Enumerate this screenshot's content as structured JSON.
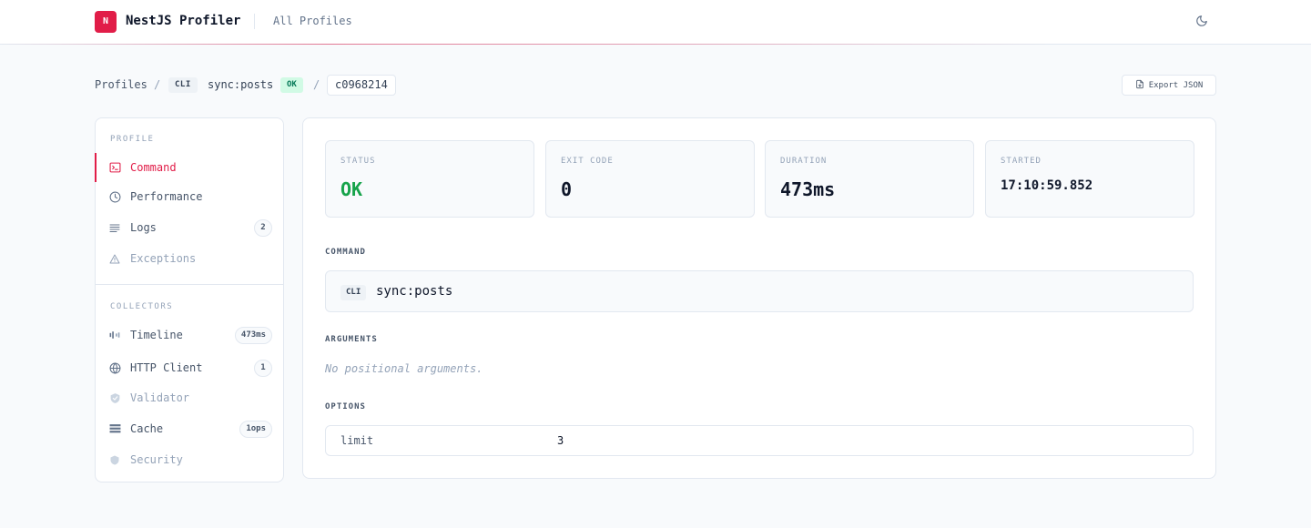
{
  "header": {
    "logo_letter": "N",
    "app_title": "NestJS Profiler",
    "all_profiles_link": "All Profiles",
    "theme_icon": "moon-icon",
    "accent_color": "#e11d48"
  },
  "breadcrumb": {
    "root": "Profiles",
    "separator": "/",
    "type_badge": "CLI",
    "command": "sync:posts",
    "status_badge": "OK",
    "profile_id": "c0968214"
  },
  "actions": {
    "export_label": "Export JSON",
    "export_icon": "file-export-icon"
  },
  "sidebar": {
    "profile_heading": "PROFILE",
    "profile_items": [
      {
        "label": "Command",
        "icon": "terminal-icon",
        "active": true
      },
      {
        "label": "Performance",
        "icon": "clock-icon"
      },
      {
        "label": "Logs",
        "icon": "list-icon",
        "count": "2"
      },
      {
        "label": "Exceptions",
        "icon": "warning-icon",
        "muted": true
      }
    ],
    "collectors_heading": "COLLECTORS",
    "collector_items": [
      {
        "label": "Timeline",
        "icon": "timeline-icon",
        "count": "473ms"
      },
      {
        "label": "HTTP Client",
        "icon": "globe-icon",
        "count": "1"
      },
      {
        "label": "Validator",
        "icon": "shield-check-icon",
        "muted": true
      },
      {
        "label": "Cache",
        "icon": "database-icon",
        "count": "1ops"
      },
      {
        "label": "Security",
        "icon": "shield-icon",
        "muted": true
      }
    ]
  },
  "stats": [
    {
      "label": "STATUS",
      "value": "OK",
      "color": "#16a34a"
    },
    {
      "label": "EXIT CODE",
      "value": "0"
    },
    {
      "label": "DURATION",
      "value": "473ms"
    },
    {
      "label": "STARTED",
      "value": "17:10:59.852"
    }
  ],
  "command_section": {
    "title": "COMMAND",
    "badge": "CLI",
    "text": "sync:posts"
  },
  "arguments_section": {
    "title": "ARGUMENTS",
    "empty_text": "No positional arguments."
  },
  "options_section": {
    "title": "OPTIONS",
    "rows": [
      {
        "key": "limit",
        "value": "3"
      }
    ]
  }
}
